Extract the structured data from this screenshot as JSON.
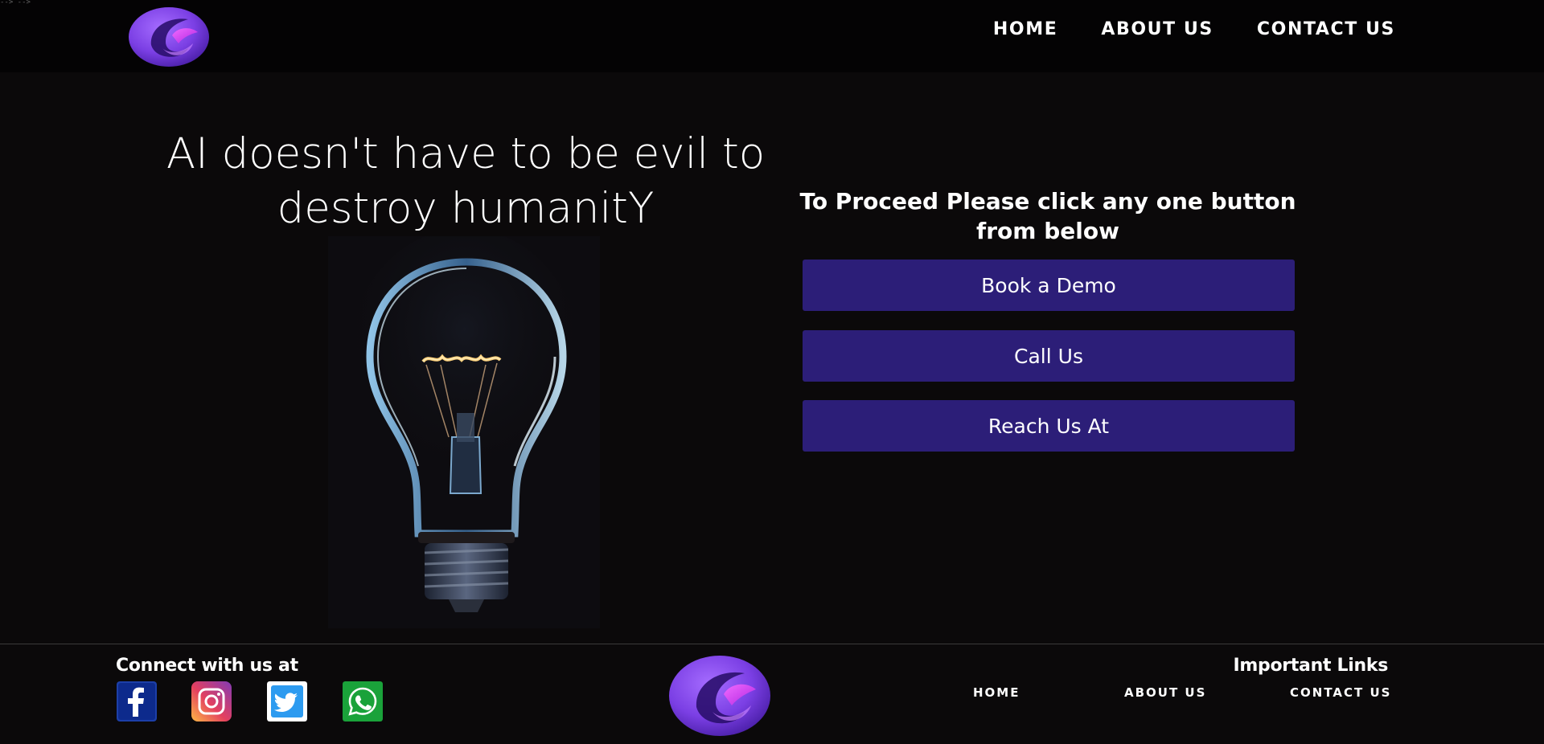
{
  "corner_text": "--> -->",
  "nav": {
    "items": [
      {
        "label": "HOME"
      },
      {
        "label": "ABOUT US"
      },
      {
        "label": "CONTACT US"
      }
    ]
  },
  "hero": {
    "title": "AI doesn't have to be evil to destroy humanitY"
  },
  "cta": {
    "heading": "To Proceed Please click any one button from below",
    "buttons": [
      {
        "label": "Book a Demo"
      },
      {
        "label": "Call Us"
      },
      {
        "label": "Reach Us At"
      }
    ]
  },
  "footer": {
    "connect_label": "Connect with us at",
    "social": [
      {
        "icon": "facebook-icon"
      },
      {
        "icon": "instagram-icon"
      },
      {
        "icon": "twitter-icon"
      },
      {
        "icon": "whatsapp-icon"
      }
    ],
    "links_title": "Important Links",
    "links": [
      {
        "label": "HOME"
      },
      {
        "label": "ABOUT US"
      },
      {
        "label": "CONTACT US"
      }
    ]
  },
  "colors": {
    "background": "#0b090a",
    "header_background": "#040304",
    "button": "#2c1e78",
    "logo_primary": "#7b3fe4",
    "logo_accent": "#d63af9"
  }
}
